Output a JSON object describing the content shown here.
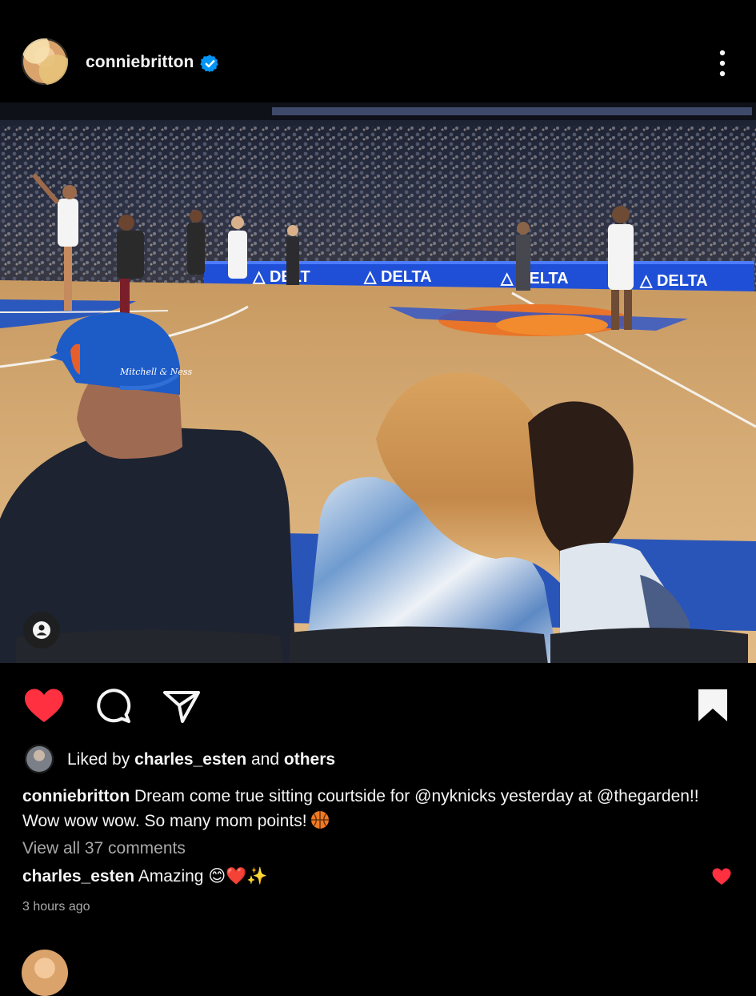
{
  "header": {
    "username": "conniebritton",
    "verified_icon": "verified-badge-icon",
    "more_icon": "more-vertical-icon"
  },
  "photo": {
    "description_icon": "basketball-court-photo",
    "banner_text": "DELTA",
    "banner_partial": "DELT",
    "tag_icon": "user-tag-icon"
  },
  "actions": {
    "like_icon": "heart-filled-icon",
    "comment_icon": "comment-icon",
    "share_icon": "send-icon",
    "save_icon": "bookmark-filled-icon",
    "like_color": "#ff3040"
  },
  "likes": {
    "prefix": "Liked by ",
    "liker": "charles_esten",
    "middle": " and ",
    "suffix": "others"
  },
  "caption": {
    "username": "conniebritton",
    "text": " Dream come true sitting courtside for @nyknicks yesterday at @thegarden!! Wow wow wow. So many mom points!",
    "emoji_icon": "basketball-emoji-icon"
  },
  "comments": {
    "view_all": "View all 37 comments",
    "top_comment": {
      "username": "charles_esten",
      "text": " Amazing ",
      "emoji": "😊❤️✨"
    }
  },
  "timestamp": "3 hours ago"
}
